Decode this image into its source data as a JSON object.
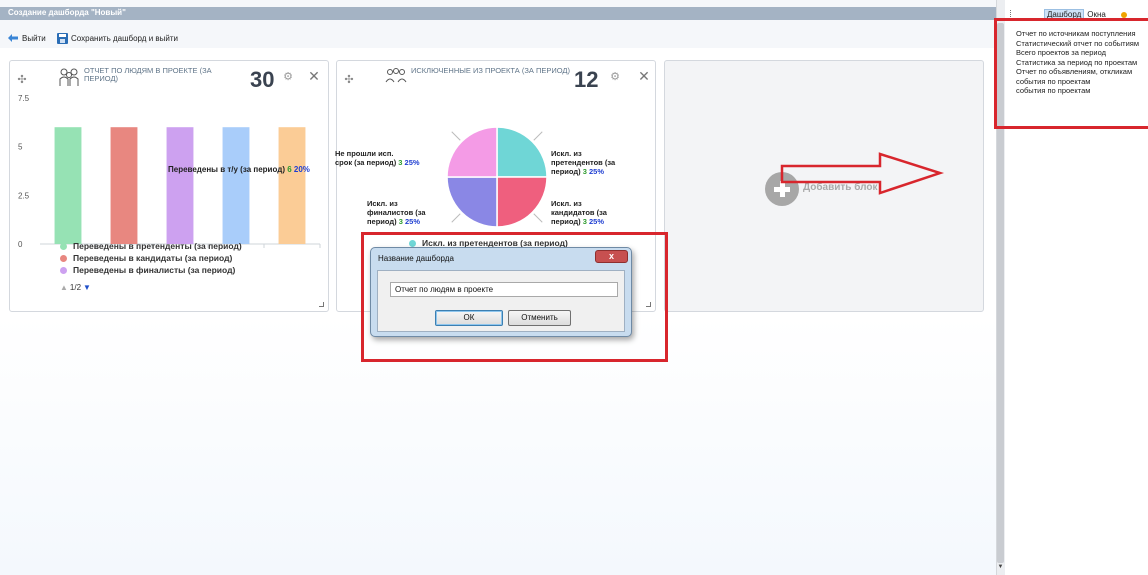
{
  "window": {
    "title": "Создание дашборда \"Новый\""
  },
  "toolbar": {
    "exit_label": "Выйти",
    "save_label": "Сохранить дашборд и выйти"
  },
  "widgets": [
    {
      "title": "ОТЧЕТ ПО ЛЮДЯМ В ПРОЕКТЕ (ЗА ПЕРИОД)",
      "count": "30",
      "tooltip": {
        "label": "Переведены в т/у (за период)",
        "value": "6",
        "percent": "20%"
      },
      "legend": [
        {
          "label": "Переведены в претенденты (за период)",
          "color": "#96e2b4"
        },
        {
          "label": "Переведены в кандидаты (за период)",
          "color": "#e88780"
        },
        {
          "label": "Переведены в финалисты (за период)",
          "color": "#cda1f0"
        }
      ],
      "pager": "1/2"
    },
    {
      "title": "ИСКЛЮЧЕННЫЕ ИЗ ПРОЕКТА (ЗА ПЕРИОД)",
      "count": "12",
      "slice_labels": [
        {
          "lines": [
            "Не прошли исп.",
            "срок (за период)"
          ],
          "value": "3",
          "percent": "25%"
        },
        {
          "lines": [
            "Искл. из",
            "претендентов (за",
            "период)"
          ],
          "value": "3",
          "percent": "25%"
        },
        {
          "lines": [
            "Искл. из",
            "финалистов (за",
            "период)"
          ],
          "value": "3",
          "percent": "25%"
        },
        {
          "lines": [
            "Искл. из",
            "кандидатов (за",
            "период)"
          ],
          "value": "3",
          "percent": "25%"
        }
      ],
      "legend": [
        {
          "label": "Искл. из претендентов (за период)",
          "color": "#6fd6d6"
        }
      ]
    }
  ],
  "add_block": {
    "label": "Добавить блок"
  },
  "dialog": {
    "title": "Название дашборда",
    "close_label": "x",
    "input_value": "Отчет по людям в проекте",
    "ok_label": "ОК",
    "cancel_label": "Отменить"
  },
  "menu": {
    "tabs": [
      "Дашборд",
      "Окна"
    ],
    "items": [
      "Отчет по источникам поступления",
      "Статистический отчет по событиям",
      "Всего проектов за период",
      "Статистика за период по проектам",
      "Отчет по объявлениям, откликам",
      "события по проектам",
      "события по проектам"
    ]
  },
  "colors": {
    "highlight": "#d8262d",
    "titlebar": "#a4b3c4",
    "accent": "#2a6db5"
  },
  "chart_data": [
    {
      "type": "bar",
      "categories": [
        "Переведены в претенденты (за период)",
        "Переведены в кандидаты (за период)",
        "Переведены в финалисты (за период)",
        "Переведены в т/у (за период)",
        ""
      ],
      "values": [
        6,
        6,
        6,
        6,
        6
      ],
      "colors": [
        "#96e2b4",
        "#e88780",
        "#cda1f0",
        "#a9cdfa",
        "#fbcc96"
      ],
      "ylim": [
        0,
        7.5
      ],
      "yticks": [
        "0",
        "2.5",
        "5",
        "7.5"
      ],
      "grid": false,
      "legend": "bottom"
    },
    {
      "type": "pie",
      "labels": [
        "Искл. из претендентов (за период)",
        "Искл. из кандидатов (за период)",
        "Искл. из финалистов (за период)",
        "Не прошли исп. срок (за период)"
      ],
      "values": [
        3,
        3,
        3,
        3
      ],
      "colors": [
        "#6fd6d6",
        "#ef5f7e",
        "#8a87e5",
        "#f49be6"
      ],
      "legend": "bottom"
    }
  ]
}
